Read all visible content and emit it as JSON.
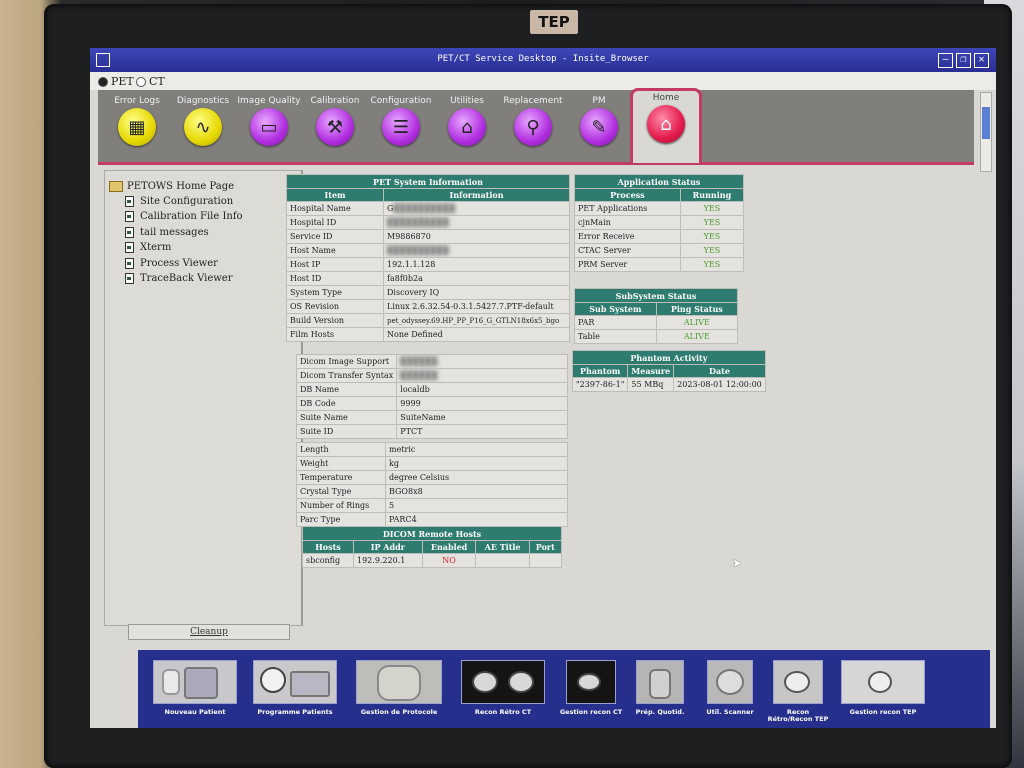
{
  "monitor": {
    "brand": "TEP"
  },
  "window": {
    "title": "PET/CT Service Desktop - Insite_Browser"
  },
  "modality": {
    "options": [
      {
        "label": "PET",
        "selected": true
      },
      {
        "label": "CT",
        "selected": false
      }
    ]
  },
  "toolbar": {
    "items": [
      {
        "label": "Error Logs",
        "icon": "log-icon",
        "color": "yellow"
      },
      {
        "label": "Diagnostics",
        "icon": "stethoscope-icon",
        "color": "yellow"
      },
      {
        "label": "Image Quality",
        "icon": "image-quality-icon",
        "color": "purple"
      },
      {
        "label": "Calibration",
        "icon": "calibration-icon",
        "color": "purple"
      },
      {
        "label": "Configuration",
        "icon": "configuration-icon",
        "color": "purple"
      },
      {
        "label": "Utilities",
        "icon": "toolbox-icon",
        "color": "purple"
      },
      {
        "label": "Replacement",
        "icon": "wrench-icon",
        "color": "purple"
      },
      {
        "label": "PM",
        "icon": "clipboard-icon",
        "color": "purple"
      },
      {
        "label": "Home",
        "icon": "home-icon",
        "color": "red",
        "active": true
      }
    ]
  },
  "tree": {
    "root": "PETOWS Home Page",
    "items": [
      "Site Configuration",
      "Calibration File Info",
      "tail messages",
      "Xterm",
      "Process Viewer",
      "TraceBack Viewer"
    ]
  },
  "cleanup_label": "Cleanup",
  "pet_system": {
    "caption": "PET System Information",
    "headers": [
      "Item",
      "Information"
    ],
    "rows": [
      [
        "Hospital Name",
        "G"
      ],
      [
        "Hospital ID",
        ""
      ],
      [
        "Service ID",
        "M9886870"
      ],
      [
        "Host Name",
        ""
      ],
      [
        "Host IP",
        "192.1.1.128"
      ],
      [
        "Host ID",
        "fa8f0b2a"
      ],
      [
        "System Type",
        "Discovery IQ"
      ],
      [
        "OS Revision",
        "Linux 2.6.32.54-0.3.1.5427.7.PTF-default"
      ],
      [
        "Build Version",
        "pet_odyssey.69.HP_PP_P16_G_GTLN18x6x5_bgo"
      ],
      [
        "Film Hosts",
        "None Defined"
      ]
    ],
    "rows2": [
      [
        "Dicom Image Support",
        ""
      ],
      [
        "Dicom Transfer Syntax",
        ""
      ],
      [
        "DB Name",
        "localdb"
      ],
      [
        "DB Code",
        "9999"
      ],
      [
        "Suite Name",
        "SuiteName"
      ],
      [
        "Suite ID",
        "PTCT"
      ]
    ],
    "rows3": [
      [
        "Length",
        "metric"
      ],
      [
        "Weight",
        "kg"
      ],
      [
        "Temperature",
        "degree Celsius"
      ],
      [
        "Crystal Type",
        "BGO8x8"
      ],
      [
        "Number of Rings",
        "5"
      ],
      [
        "Parc Type",
        "PARC4"
      ]
    ]
  },
  "dicom_hosts": {
    "caption": "DICOM Remote Hosts",
    "headers": [
      "Hosts",
      "IP Addr",
      "Enabled",
      "AE Title",
      "Port"
    ],
    "rows": [
      [
        "sbconfig",
        "192.9.220.1",
        "NO",
        "",
        ""
      ]
    ]
  },
  "app_status": {
    "caption": "Application Status",
    "headers": [
      "Process",
      "Running"
    ],
    "rows": [
      [
        "PET Applications",
        "YES"
      ],
      [
        "cjnMain",
        "YES"
      ],
      [
        "Error Receive",
        "YES"
      ],
      [
        "CTAC Server",
        "YES"
      ],
      [
        "PRM Server",
        "YES"
      ]
    ]
  },
  "subsystem_status": {
    "caption": "SubSystem Status",
    "headers": [
      "Sub System",
      "Ping Status"
    ],
    "rows": [
      [
        "PAR",
        "ALIVE"
      ],
      [
        "Table",
        "ALIVE"
      ]
    ]
  },
  "phantom": {
    "caption": "Phantom Activity",
    "headers": [
      "Phantom",
      "Measure",
      "Date"
    ],
    "rows": [
      [
        "\"2397-86-1\"",
        "55 MBq",
        "2023-08-01 12:00:00"
      ]
    ]
  },
  "taskbar": {
    "items": [
      {
        "label": "Nouveau Patient"
      },
      {
        "label": "Programme Patients"
      },
      {
        "label": "Gestion de Protocole"
      },
      {
        "label": "Recon Rétro CT"
      },
      {
        "label": "Gestion recon CT"
      },
      {
        "label": "Prép. Quotid."
      },
      {
        "label": "Util. Scanner"
      },
      {
        "label": "Recon Rétro/Recon TEP"
      },
      {
        "label": "Gestion recon TEP"
      }
    ]
  }
}
